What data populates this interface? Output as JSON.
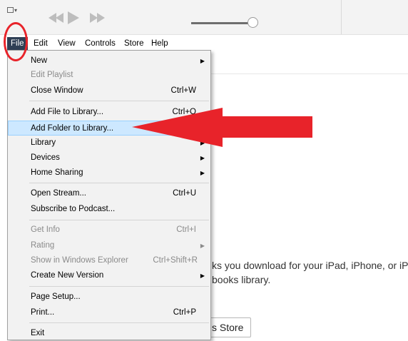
{
  "menubar": {
    "file": "File",
    "edit": "Edit",
    "view": "View",
    "controls": "Controls",
    "store": "Store",
    "help": "Help"
  },
  "file_menu": {
    "new": "New",
    "edit_playlist": "Edit Playlist",
    "close_window": "Close Window",
    "close_window_shortcut": "Ctrl+W",
    "add_file": "Add File to Library...",
    "add_file_shortcut": "Ctrl+O",
    "add_folder": "Add Folder to Library...",
    "library": "Library",
    "devices": "Devices",
    "home_sharing": "Home Sharing",
    "open_stream": "Open Stream...",
    "open_stream_shortcut": "Ctrl+U",
    "subscribe_podcast": "Subscribe to Podcast...",
    "get_info": "Get Info",
    "get_info_shortcut": "Ctrl+I",
    "rating": "Rating",
    "show_explorer": "Show in Windows Explorer",
    "show_explorer_shortcut": "Ctrl+Shift+R",
    "create_version": "Create New Version",
    "page_setup": "Page Setup...",
    "print": "Print...",
    "print_shortcut": "Ctrl+P",
    "exit": "Exit"
  },
  "background": {
    "line1": "ks you download for your iPad, iPhone, or iP",
    "line2": "books library.",
    "store_button": "s Store"
  },
  "icons": {
    "submenu_arrow": "▶",
    "window_icon": "window-icon"
  },
  "colors": {
    "highlight": "#cde8ff",
    "annotation_red": "#e8232a",
    "file_menu_active": "#2f3f55"
  },
  "player": {
    "volume_level": 0.93
  }
}
